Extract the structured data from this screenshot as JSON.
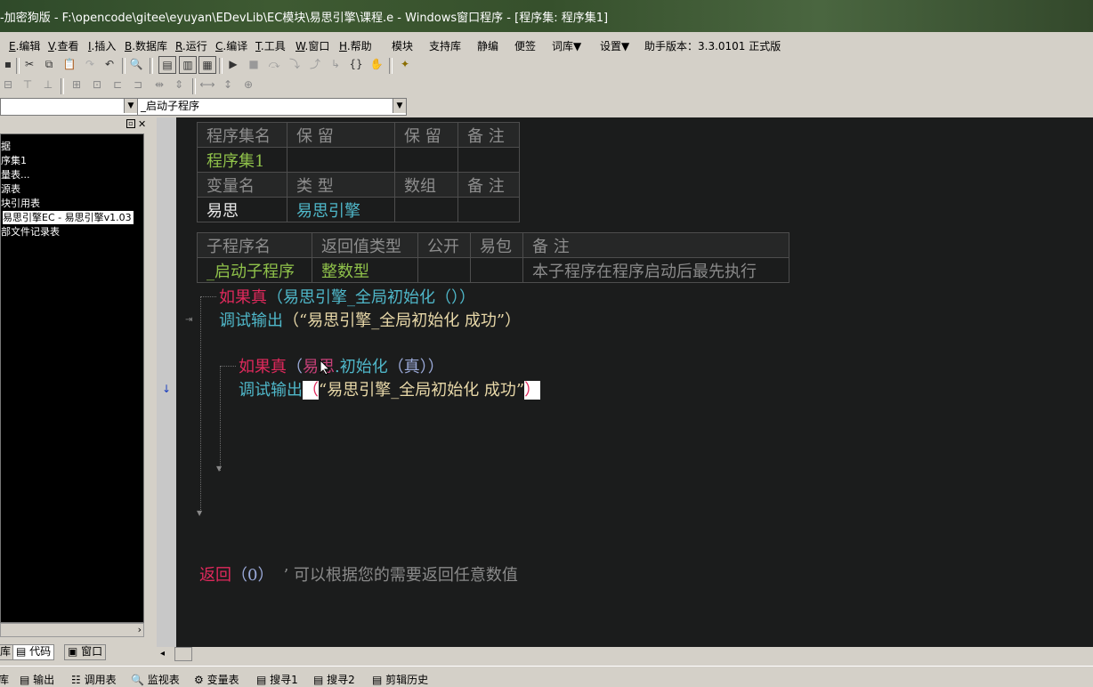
{
  "window": {
    "title": "-加密狗版 - F:\\opencode\\gitee\\eyuyan\\EDevLib\\EC模块\\易思引擎\\课程.e - Windows窗口程序 - [程序集: 程序集1]"
  },
  "menubar": {
    "items": [
      {
        "key": "E",
        "label": ".编辑"
      },
      {
        "key": "V",
        "label": ".查看"
      },
      {
        "key": "I",
        "label": ".插入"
      },
      {
        "key": "B",
        "label": ".数据库"
      },
      {
        "key": "R",
        "label": ".运行"
      },
      {
        "key": "C",
        "label": ".编译"
      },
      {
        "key": "T",
        "label": ".工具"
      },
      {
        "key": "W",
        "label": ".窗口"
      },
      {
        "key": "H",
        "label": ".帮助"
      }
    ],
    "extras": [
      "模块",
      "支持库",
      "静编",
      "便签",
      "词库▼",
      "设置▼"
    ],
    "version": "助手版本：3.3.0101 正式版"
  },
  "combos": {
    "left_value": "",
    "right_value": "_启动子程序"
  },
  "tree": {
    "items": [
      "据",
      "序集1",
      "量表...",
      "源表",
      "块引用表",
      "易思引擎EC - 易思引擎v1.03",
      "部文件记录表"
    ],
    "selected_index": 5
  },
  "left_tabs": [
    "库",
    "代码",
    "窗口"
  ],
  "assembly_table": {
    "header": [
      "程序集名",
      "保 留",
      "保 留",
      "备 注"
    ],
    "row": [
      "程序集1",
      "",
      "",
      ""
    ],
    "var_header": [
      "变量名",
      "类 型",
      "数组",
      "备 注"
    ],
    "var_row": [
      "易思",
      "易思引擎",
      "",
      ""
    ]
  },
  "sub_table": {
    "header": [
      "子程序名",
      "返回值类型",
      "公开",
      "易包",
      "备 注"
    ],
    "row": [
      "_启动子程序",
      "整数型",
      "",
      "",
      "本子程序在程序启动后最先执行"
    ]
  },
  "code": {
    "line1_kw": "如果真",
    "line1_rest": "（易思引擎_全局初始化（））",
    "line2_kw": "调试输出",
    "line2_rest": "（“易思引擎_全局初始化 成功”）",
    "line3_kw": "如果真",
    "line3_open": "（",
    "line3_obj": "易思",
    "line3_method": ".初始化",
    "line3_arg": "（真））",
    "line4_kw": "调试输出",
    "line4_open": "（",
    "line4_str": "“易思引擎_全局初始化 成功”",
    "line4_close": "）",
    "return_kw": "返回",
    "return_val": "（0）",
    "return_comment": "’ 可以根据您的需要返回任意数值"
  },
  "bottom_tabs": [
    "库",
    "输出",
    "调用表",
    "监视表",
    "变量表",
    "搜寻1",
    "搜寻2",
    "剪辑历史"
  ],
  "colors": {
    "editor_bg": "#1b1c1c",
    "keyword": "#e0295c",
    "command": "#4fb7c9",
    "string": "#e8d8a8",
    "green": "#8fc14a"
  }
}
